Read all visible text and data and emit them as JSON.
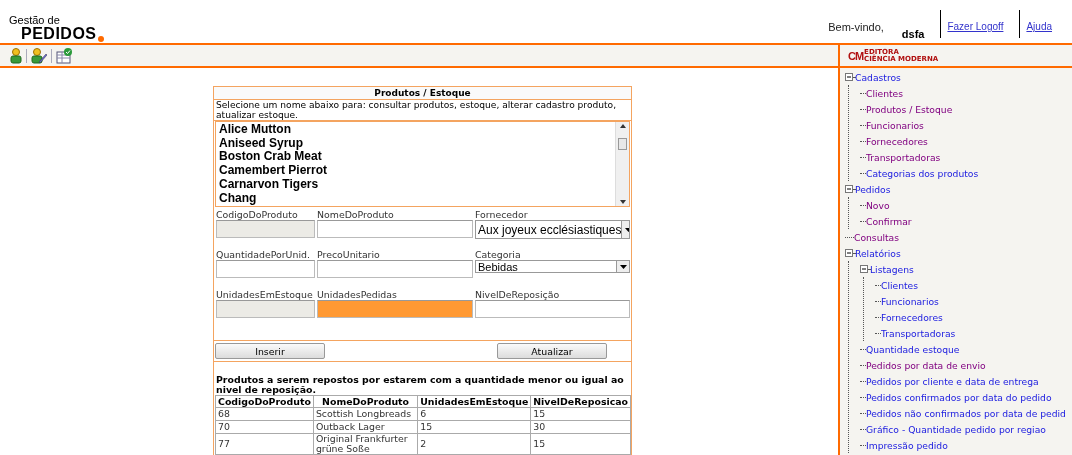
{
  "header": {
    "logo_small": "Gestão de",
    "logo_big": "PEDIDOS",
    "welcome": "Bem-vindo,",
    "user": "dsfa",
    "links": [
      {
        "label": "Fazer Logoff"
      },
      {
        "label": "Ajuda"
      }
    ]
  },
  "toolbar": {
    "tools": [
      {
        "kind": "person"
      },
      {
        "kind": "edit-person"
      },
      {
        "kind": "table-check"
      }
    ]
  },
  "publisher_logo": {
    "mark": "CM",
    "top": "EDITORA",
    "name": "CIÊNCIA MODERNA"
  },
  "form": {
    "title": "Produtos / Estoque",
    "instructions": "Selecione um nome abaixo para: consultar produtos, estoque, alterar cadastro produto, atualizar estoque.",
    "products": [
      "Alice Mutton",
      "Aniseed Syrup",
      "Boston Crab Meat",
      "Camembert Pierrot",
      "Carnarvon Tigers",
      "Chang"
    ],
    "fields": [
      {
        "label": "CodigoDoProduto",
        "kind": "text",
        "disabled": true,
        "focused": false
      },
      {
        "label": "NomeDoProduto",
        "kind": "text",
        "disabled": false,
        "focused": false
      },
      {
        "label": "Fornecedor",
        "kind": "select",
        "value": "Aux joyeux ecclésiastiques",
        "disabled": false,
        "focused": false
      },
      {
        "label": "QuantidadePorUnid.",
        "kind": "text",
        "disabled": false,
        "focused": false
      },
      {
        "label": "PrecoUnitario",
        "kind": "text",
        "disabled": false,
        "focused": false
      },
      {
        "label": "Categoria",
        "kind": "select",
        "value": "Bebidas",
        "disabled": false,
        "focused": false
      },
      {
        "label": "UnidadesEmEstoque",
        "kind": "text",
        "disabled": true,
        "focused": false
      },
      {
        "label": "UnidadesPedidas",
        "kind": "text",
        "disabled": false,
        "focused": true
      },
      {
        "label": "NivelDeReposição",
        "kind": "text",
        "disabled": false,
        "focused": false
      }
    ],
    "buttons": [
      "Inserir",
      "Atualizar"
    ],
    "restock_note": "Produtos a serem repostos por estarem com a quantidade menor ou igual ao nivel de reposição.",
    "table": {
      "columns": [
        "CodigoDoProduto",
        "NomeDoProduto",
        "UnidadesEmEstoque",
        "NivelDeReposicao"
      ],
      "rows": [
        [
          "68",
          "Scottish Longbreads",
          "6",
          "15"
        ],
        [
          "70",
          "Outback Lager",
          "15",
          "30"
        ],
        [
          "77",
          "Original Frankfurter grüne Soße",
          "2",
          "15"
        ]
      ]
    }
  },
  "menu_tree": [
    {
      "label": "Cadastros",
      "expanded": true,
      "visited": false,
      "children": [
        {
          "label": "Clientes",
          "visited": true
        },
        {
          "label": "Produtos / Estoque",
          "visited": true
        },
        {
          "label": "Funcionarios",
          "visited": true
        },
        {
          "label": "Fornecedores",
          "visited": true
        },
        {
          "label": "Transportadoras",
          "visited": true
        },
        {
          "label": "Categorias dos produtos",
          "visited": false
        }
      ]
    },
    {
      "label": "Pedidos",
      "expanded": true,
      "visited": false,
      "children": [
        {
          "label": "Novo",
          "visited": true
        },
        {
          "label": "Confirmar",
          "visited": true
        }
      ]
    },
    {
      "label": "Consultas",
      "visited": true
    },
    {
      "label": "Relatórios",
      "expanded": true,
      "visited": false,
      "children": [
        {
          "label": "Listagens",
          "expanded": true,
          "visited": false,
          "children": [
            {
              "label": "Clientes",
              "visited": false
            },
            {
              "label": "Funcionarios",
              "visited": false
            },
            {
              "label": "Fornecedores",
              "visited": false
            },
            {
              "label": "Transportadoras",
              "visited": false
            }
          ]
        },
        {
          "label": "Quantidade estoque",
          "visited": false
        },
        {
          "label": "Pedidos por data de envio",
          "visited": true
        },
        {
          "label": "Pedidos por cliente e data de entrega",
          "visited": false
        },
        {
          "label": "Pedidos confirmados por data do pedido",
          "visited": false
        },
        {
          "label": "Pedidos não confirmados por data de pedid",
          "visited": false
        },
        {
          "label": "Gráfico - Quantidade pedido por regiao",
          "visited": false
        },
        {
          "label": "Impressão pedido",
          "visited": false
        }
      ]
    }
  ]
}
